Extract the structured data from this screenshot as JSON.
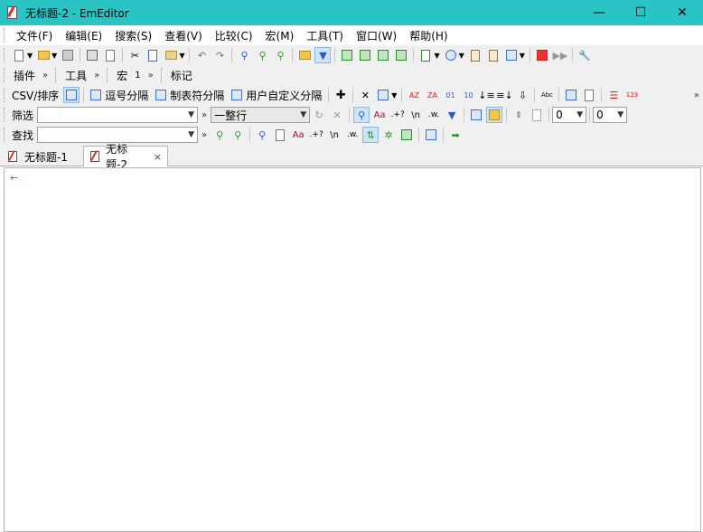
{
  "window": {
    "title": "无标题-2 - EmEditor",
    "title_bar_color": "#2bc4c4",
    "controls": {
      "minimize": "—",
      "maximize": "☐",
      "close": "✕"
    }
  },
  "menu": {
    "items": [
      {
        "label": "文件(F)"
      },
      {
        "label": "编辑(E)"
      },
      {
        "label": "搜索(S)"
      },
      {
        "label": "查看(V)"
      },
      {
        "label": "比较(C)"
      },
      {
        "label": "宏(M)"
      },
      {
        "label": "工具(T)"
      },
      {
        "label": "窗口(W)"
      },
      {
        "label": "帮助(H)"
      }
    ]
  },
  "toolbars": {
    "plugins_label": "插件",
    "tools_label": "工具",
    "macros_label": "宏",
    "macro_marker": "1",
    "marker_label": "标记",
    "overflow_chevron": "»",
    "csv_label": "CSV/排序",
    "csv_modes": [
      {
        "label": "逗号分隔"
      },
      {
        "label": "制表符分隔"
      },
      {
        "label": "用户自定义分隔"
      }
    ],
    "filter_label": "筛选",
    "filter_input_value": "",
    "filter_mode_value": "一整行",
    "filter_symbols": {
      "aa": "Aa",
      "regex": ".+?",
      "newline": "\\n",
      "word": ".w."
    },
    "number1_value": "0",
    "number2_value": "0",
    "find_label": "查找",
    "find_input_value": "",
    "sort_glyphs": {
      "az": "AZ",
      "za": "ZA",
      "n01": "01",
      "n10": "10",
      "abc": "Abc",
      "n123": "123"
    }
  },
  "tabs": [
    {
      "label": "无标题-1",
      "active": false
    },
    {
      "label": "无标题-2",
      "active": true,
      "close": "×"
    }
  ],
  "editor": {
    "eof_marker": "←",
    "eof_color": "#3b6fd0"
  }
}
